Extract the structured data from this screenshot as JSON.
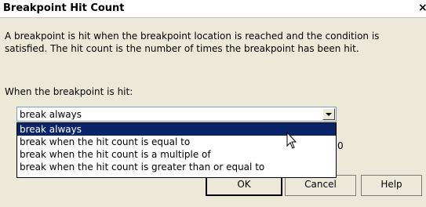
{
  "dialog": {
    "title": "Breakpoint Hit Count",
    "close_glyph": "×"
  },
  "description": "A breakpoint is hit when the breakpoint location is reached and the condition is satisfied. The hit count is the number of times the breakpoint has been hit.",
  "when_label": "When the breakpoint is hit:",
  "combo": {
    "selected": "break always",
    "options": [
      "break always",
      "break when the hit count is equal to",
      "break when the hit count is a multiple of",
      "break when the hit count is greater than or equal to"
    ]
  },
  "partial_text": "0",
  "buttons": {
    "ok": "OK",
    "cancel": "Cancel",
    "help": "Help"
  }
}
